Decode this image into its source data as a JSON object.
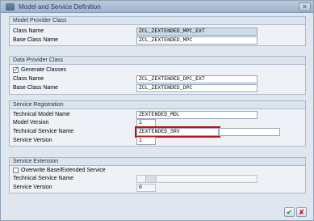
{
  "window": {
    "title": "Model and Service Definition"
  },
  "model_provider": {
    "header": "Model Provider Class",
    "class_label": "Class Name",
    "class_value": "ZCL_ZEXTENDED_MPC_EXT",
    "base_label": "Base Class Name",
    "base_value": "ZCL_ZEXTENDED_MPC"
  },
  "data_provider": {
    "header": "Data Provider Class",
    "generate_label": "Generate Classes",
    "generate_checked": true,
    "class_label": "Class Name",
    "class_value": "ZCL_ZEXTENDED_DPC_EXT",
    "base_label": "Base Class Name",
    "base_value": "ZCL_ZEXTENDED_DPC"
  },
  "service_registration": {
    "header": "Service Registration",
    "tech_model_label": "Technical Model Name",
    "tech_model_value": "ZEXTENDED_MDL",
    "model_version_label": "Model Version",
    "model_version_value": "1",
    "tech_service_label": "Technical Service Name",
    "tech_service_value": "ZEXTENDED_SRV",
    "service_version_label": "Service Version",
    "service_version_value": "1"
  },
  "service_extension": {
    "header": "Service Extension",
    "overwrite_label": "Overwrite Base/Extended Service",
    "overwrite_checked": false,
    "tech_service_label": "Technical Service Name",
    "tech_service_value": "",
    "service_version_label": "Service Version",
    "service_version_value": "0"
  },
  "footer": {
    "ok_glyph": "✔",
    "cancel_glyph": "✘"
  },
  "colors": {
    "ok": "#2e8b2e",
    "cancel": "#c0101b",
    "highlight_border": "#c0101b"
  }
}
